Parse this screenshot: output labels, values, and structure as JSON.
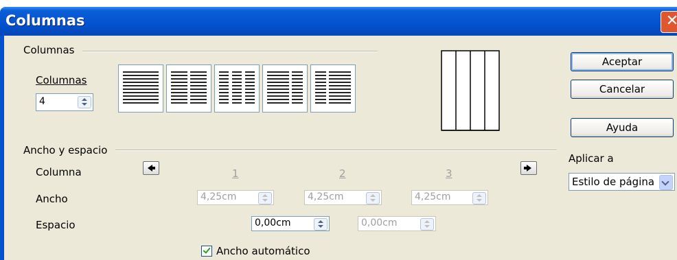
{
  "window": {
    "title": "Columnas",
    "close_glyph": "✕"
  },
  "columns_section": {
    "title": "Columnas",
    "count_label": "Columnas",
    "count_value": "4",
    "preset_icons": [
      "one-column-preset-icon",
      "two-columns-preset-icon",
      "three-columns-preset-icon",
      "two-columns-wide-left-preset-icon",
      "two-columns-wide-right-preset-icon"
    ],
    "preview_columns": 4
  },
  "width_spacing": {
    "title": "Ancho y espacio",
    "column_label": "Columna",
    "width_label": "Ancho",
    "spacing_label": "Espacio",
    "column_numbers": [
      "1",
      "2",
      "3"
    ],
    "widths": [
      "4,25cm",
      "4,25cm",
      "4,25cm"
    ],
    "spacings": [
      "0,00cm",
      "0,00cm"
    ],
    "auto_width_label": "Ancho automático",
    "auto_width_checked": true
  },
  "buttons": {
    "ok": "Aceptar",
    "cancel": "Cancelar",
    "help": "Ayuda"
  },
  "apply_to": {
    "label": "Aplicar a",
    "value": "Estilo de página"
  },
  "colors": {
    "titlebar": "#0451cf",
    "dialog_bg": "#ece9d8",
    "close_button": "#e0562f"
  }
}
